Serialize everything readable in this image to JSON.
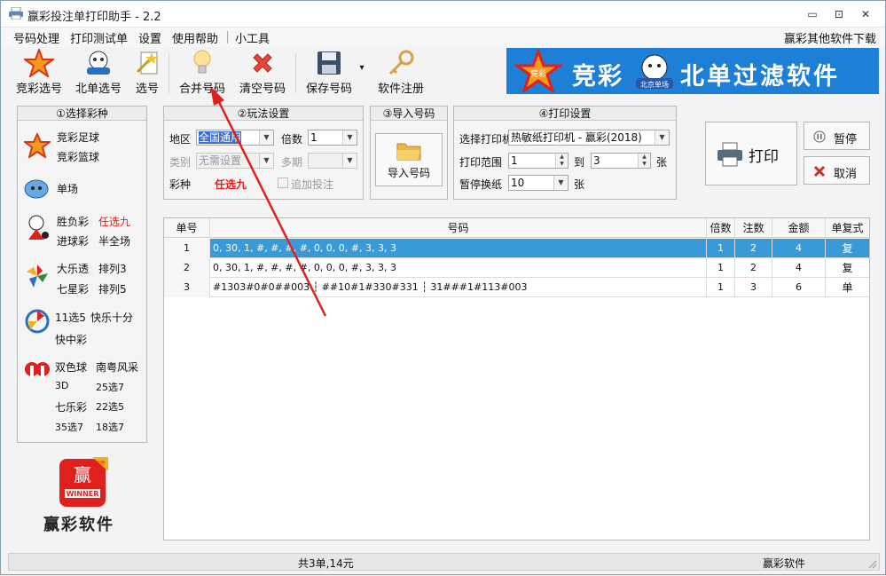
{
  "window": {
    "title": "赢彩投注单打印助手 - 2.2",
    "min": "▭",
    "restore": "⊡",
    "close": "✕"
  },
  "menu": {
    "items": [
      "号码处理",
      "打印测试单",
      "设置",
      "使用帮助",
      "小工具"
    ],
    "right": "赢彩其他软件下载"
  },
  "toolbar": {
    "jingcai": "竞彩选号",
    "beidan": "北单选号",
    "xuanhao": "选号",
    "merge": "合并号码",
    "clear": "清空号码",
    "save": "保存号码",
    "register": "软件注册",
    "dropdown": "▾"
  },
  "banner": {
    "left": "竞彩",
    "right": "北单过滤软件",
    "badge_left": "竞彩",
    "badge_right": "北京单场"
  },
  "lottery": {
    "title": "①选择彩种",
    "jczq": "竞彩足球",
    "jclq": "竞彩篮球",
    "danchang": "单场",
    "shengfucai": "胜负彩",
    "renxuan9": "任选九",
    "jinqiucai": "进球彩",
    "banquanchang": "半全场",
    "daletou": "大乐透",
    "pailie3": "排列3",
    "qixingcai": "七星彩",
    "pailie5": "排列5",
    "syxw": "11选5",
    "kuaile10": "快乐十分",
    "kuaizhongcai": "快中彩",
    "shuangseqiu": "双色球",
    "nanyue": "南粤风采",
    "fc3d": "3D",
    "x25x7": "25选7",
    "qilecai": "七乐彩",
    "x22x5": "22选5",
    "x35x7": "35选7",
    "x18x7": "18选7",
    "brand": "赢彩软件",
    "logo_top": "赢",
    "logo_badge": "软件",
    "logo_text": "WINNER"
  },
  "play": {
    "title": "②玩法设置",
    "region_label": "地区",
    "region_value": "全国通用",
    "multiplier_label": "倍数",
    "multiplier_value": "1",
    "type_label": "类别",
    "type_value": "无需设置",
    "period_label": "多期",
    "period_value": "",
    "kind_label": "彩种",
    "kind_value": "任选九",
    "add_bet": "追加投注"
  },
  "import": {
    "title": "③导入号码",
    "button": "导入号码"
  },
  "print": {
    "title": "④打印设置",
    "printer_label": "选择打印机",
    "printer_value": "热敏纸打印机 - 赢彩(2018)",
    "range_label": "打印范围",
    "range_from": "1",
    "range_to_label": "到",
    "range_to": "3",
    "unit1": "张",
    "pause_label": "暂停换纸",
    "pause_value": "10",
    "unit2": "张"
  },
  "actions": {
    "print": "打印",
    "pause": "暂停",
    "cancel": "取消"
  },
  "grid": {
    "headers": [
      "单号",
      "号码",
      "倍数",
      "注数",
      "金额",
      "单复式"
    ],
    "rows": [
      {
        "no": "1",
        "code": "0, 30, 1, #, #, #, #, 0, 0, 0, #, 3, 3, 3",
        "mult": "1",
        "bets": "2",
        "amount": "4",
        "type": "复"
      },
      {
        "no": "2",
        "code": "0, 30, 1, #, #, #, #, 0, 0, 0, #, 3, 3, 3",
        "mult": "1",
        "bets": "2",
        "amount": "4",
        "type": "复"
      },
      {
        "no": "3",
        "code": "#1303#0#0##003 ┆ ##10#1#330#331 ┆ 31###1#113#003",
        "mult": "1",
        "bets": "3",
        "amount": "6",
        "type": "单"
      }
    ]
  },
  "status": {
    "summary": "共3单,14元",
    "brand": "赢彩软件"
  },
  "colors": {
    "accent": "#1e7fd6",
    "selection": "#3a9ad9",
    "highlight": "#e0201c"
  }
}
